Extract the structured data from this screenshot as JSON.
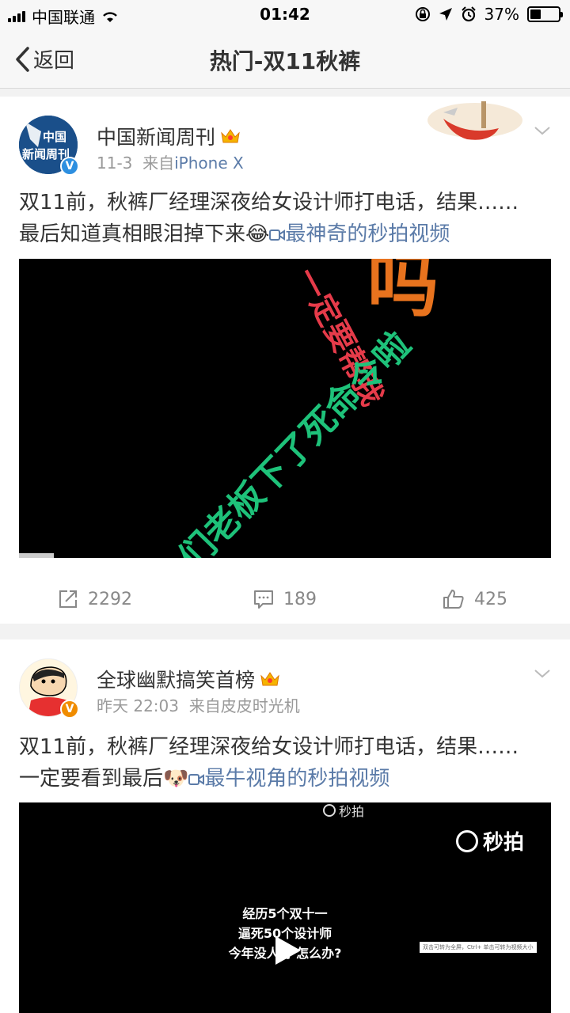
{
  "status_bar": {
    "carrier": "中国联通",
    "time": "01:42",
    "battery_percent": "37%",
    "battery_level": 0.37
  },
  "nav": {
    "back_label": "返回",
    "title": "热门-双11秋裤"
  },
  "posts": [
    {
      "author": "中国新闻周刊",
      "avatar_text": "中国新闻周刊",
      "verified_badge": "V",
      "time": "11-3",
      "source_prefix": "来自",
      "source": "iPhone X",
      "text_line1": "双11前，秋裤厂经理深夜给女设计师打电话，结果……",
      "text_line2": "最后知道真相眼泪掉下来",
      "emoji": "😂",
      "video_link": "最神奇的秒拍视频",
      "video_overlay": {
        "text_a": "吗",
        "text_b": "一定要帮我",
        "text_c": "们老板下了死命令啦"
      },
      "video_progress": 0.066,
      "reposts": "2292",
      "comments": "189",
      "likes": "425"
    },
    {
      "author": "全球幽默搞笑首榜",
      "verified_badge": "V",
      "time": "昨天 22:03",
      "source_prefix": "来自",
      "source": "皮皮时光机",
      "text_line1": "双11前，秋裤厂经理深夜给女设计师打电话，结果……",
      "text_line2": "一定要看到最后",
      "emoji": "🐶",
      "video_link": "最牛视角的秒拍视频",
      "video_overlay": {
        "watermark_top": "秒拍",
        "watermark_brand": "秒拍",
        "line1": "经历5个双十一",
        "line2": "逼死50个设计师",
        "line3": "今年没人背 怎么办?",
        "hint": "双击可转为全屏，Ctrl+ 单击可转为视频大小"
      }
    }
  ],
  "colors": {
    "link": "#5b7ba8",
    "meta": "#999999",
    "card_bg": "#ffffff",
    "page_bg": "#f2f2f2"
  }
}
